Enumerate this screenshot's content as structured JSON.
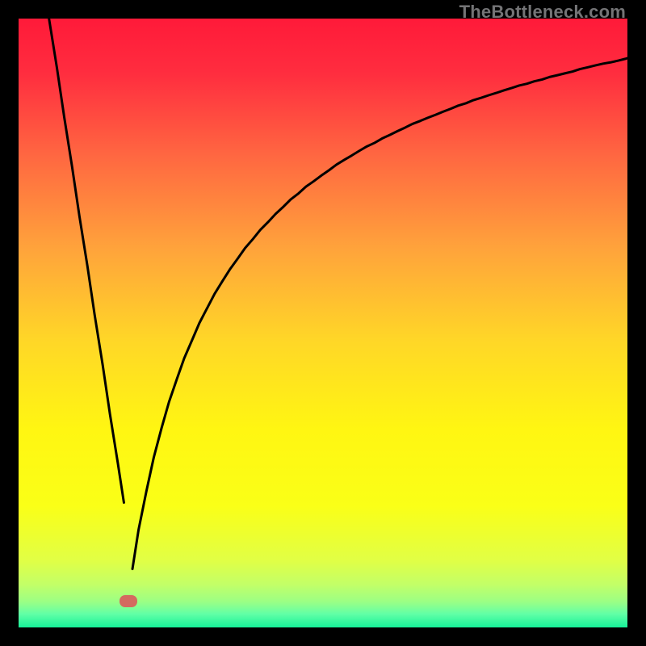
{
  "watermark": {
    "text": "TheBottleneck.com"
  },
  "chart_data": {
    "type": "line",
    "title": "",
    "xlabel": "",
    "ylabel": "",
    "xlim": [
      0,
      100
    ],
    "ylim": [
      0,
      100
    ],
    "series": [
      {
        "name": "left-branch",
        "x": [
          5.0,
          6.3,
          7.5,
          8.8,
          10.0,
          11.3,
          12.5,
          13.8,
          15.0,
          16.3,
          17.3
        ],
        "y": [
          100,
          91.9,
          83.8,
          75.6,
          67.5,
          59.4,
          51.3,
          43.2,
          35.1,
          27.0,
          20.5
        ]
      },
      {
        "name": "right-branch",
        "x": [
          18.7,
          19.7,
          21.0,
          22.2,
          23.5,
          24.7,
          26.0,
          27.2,
          28.5,
          29.7,
          31.0,
          32.2,
          33.5,
          34.7,
          36.0,
          37.2,
          38.5,
          39.7,
          41.0,
          42.2,
          43.5,
          44.7,
          46.0,
          47.2,
          48.5,
          49.7,
          51.0,
          52.2,
          53.5,
          54.7,
          56.0,
          57.2,
          58.5,
          59.7,
          61.0,
          62.2,
          63.5,
          64.7,
          66.0,
          67.2,
          68.5,
          69.7,
          71.0,
          72.2,
          73.5,
          74.7,
          76.0,
          77.2,
          78.5,
          79.7,
          81.0,
          82.2,
          83.5,
          84.7,
          86.0,
          87.2,
          88.5,
          89.7,
          91.0,
          92.2,
          93.5,
          94.7,
          96.0,
          97.2,
          98.5,
          99.7,
          100.0
        ],
        "y": [
          9.6,
          16.0,
          22.4,
          27.9,
          32.8,
          37.0,
          40.8,
          44.2,
          47.2,
          50.0,
          52.5,
          54.8,
          56.9,
          58.8,
          60.6,
          62.3,
          63.8,
          65.3,
          66.6,
          67.9,
          69.1,
          70.3,
          71.3,
          72.4,
          73.3,
          74.2,
          75.1,
          76.0,
          76.8,
          77.5,
          78.3,
          79.0,
          79.6,
          80.3,
          80.9,
          81.5,
          82.1,
          82.7,
          83.2,
          83.7,
          84.2,
          84.7,
          85.2,
          85.7,
          86.1,
          86.6,
          87.0,
          87.4,
          87.8,
          88.2,
          88.6,
          89.0,
          89.3,
          89.7,
          90.0,
          90.4,
          90.7,
          91.0,
          91.3,
          91.7,
          92.0,
          92.3,
          92.6,
          92.8,
          93.1,
          93.4,
          93.5
        ]
      }
    ],
    "grid": false,
    "legend": false,
    "marker": {
      "x": 18.0,
      "y": 4.3,
      "w_pct": 2.9,
      "h_pct": 1.9
    },
    "gradient_stops": [
      {
        "offset": 0.0,
        "color": "#ff1a39"
      },
      {
        "offset": 0.09,
        "color": "#ff2d3f"
      },
      {
        "offset": 0.225,
        "color": "#ff6741"
      },
      {
        "offset": 0.38,
        "color": "#ffa43b"
      },
      {
        "offset": 0.53,
        "color": "#ffd727"
      },
      {
        "offset": 0.675,
        "color": "#fff612"
      },
      {
        "offset": 0.8,
        "color": "#faff17"
      },
      {
        "offset": 0.89,
        "color": "#e1ff45"
      },
      {
        "offset": 0.93,
        "color": "#c2ff68"
      },
      {
        "offset": 0.958,
        "color": "#9bff85"
      },
      {
        "offset": 0.978,
        "color": "#61ffa6"
      },
      {
        "offset": 1.0,
        "color": "#16f199"
      }
    ]
  }
}
